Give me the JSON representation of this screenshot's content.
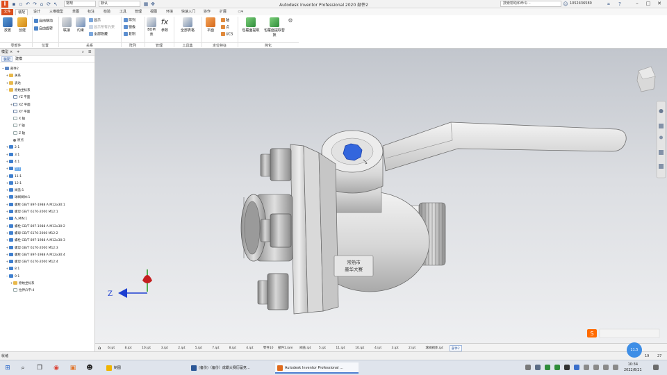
{
  "titlebar": {
    "app_letter": "I",
    "quick_access_icons": [
      "new-icon",
      "open-icon",
      "save-icon",
      "undo-icon",
      "redo-icon",
      "home-icon"
    ],
    "appearance_combo": "常规",
    "material_combo": "默认",
    "window_title": "Autodesk Inventor Professional 2020   部件2",
    "search_placeholder": "搜索帮助和命令...",
    "user_name": "1052436580",
    "window_controls": [
      "minimize",
      "maximize",
      "close"
    ]
  },
  "ribbon_tabs": {
    "file": "文件",
    "items": [
      "装配",
      "设计",
      "三维模型",
      "草图",
      "标注",
      "检验",
      "工具",
      "管理",
      "视图",
      "环境",
      "快速入门",
      "协作",
      "扩展"
    ],
    "active_index": 0
  },
  "ribbon": {
    "buttons": {
      "place": "放置",
      "create": "创建",
      "free_move": "自由移动",
      "free_rotate": "自由旋转",
      "joint": "联接",
      "constrain": "约束",
      "show": "显示",
      "show_constraints": "显示所有约束",
      "hide_all": "全部隐藏",
      "pattern": "阵列",
      "mirror": "镜像",
      "copy": "复制",
      "bom": "BOM表",
      "parameters": "参数",
      "ipart_table": "全部表格",
      "plane": "平面",
      "axis": "轴",
      "point": "点",
      "ucs": "UCS",
      "envelope": "包覆面提取",
      "envelope2": "包覆面提取替换"
    },
    "groups": [
      "零部件",
      "位置",
      "关系",
      "阵列",
      "管理",
      "工具集",
      "定位特征",
      "简化"
    ]
  },
  "browser": {
    "panel_title": "模型",
    "tabs": [
      "装配",
      "建模"
    ],
    "active_tab": 0,
    "tree": [
      {
        "label": "部件2",
        "indent": 0,
        "icon": "root",
        "exp": "−"
      },
      {
        "label": "关系",
        "indent": 1,
        "icon": "folder",
        "exp": "+"
      },
      {
        "label": "表达",
        "indent": 1,
        "icon": "folder",
        "exp": "+"
      },
      {
        "label": "原始坐标系",
        "indent": 1,
        "icon": "folder",
        "exp": "−"
      },
      {
        "label": "YZ 平面",
        "indent": 2,
        "icon": "plane",
        "exp": ""
      },
      {
        "label": "XZ 平面",
        "indent": 2,
        "icon": "plane",
        "exp": "+"
      },
      {
        "label": "XY 平面",
        "indent": 2,
        "icon": "plane",
        "exp": ""
      },
      {
        "label": "X 轴",
        "indent": 2,
        "icon": "axis",
        "exp": ""
      },
      {
        "label": "Y 轴",
        "indent": 2,
        "icon": "axis",
        "exp": ""
      },
      {
        "label": "Z 轴",
        "indent": 2,
        "icon": "axis",
        "exp": ""
      },
      {
        "label": "原点",
        "indent": 2,
        "icon": "point",
        "exp": ""
      },
      {
        "label": "2:1",
        "indent": 1,
        "icon": "part",
        "exp": "+"
      },
      {
        "label": "3:1",
        "indent": 1,
        "icon": "part",
        "exp": "+"
      },
      {
        "label": "4:1",
        "indent": 1,
        "icon": "part",
        "exp": "+"
      },
      {
        "label": "5:1",
        "indent": 1,
        "icon": "part",
        "exp": "+",
        "selected": true
      },
      {
        "label": "11:1",
        "indent": 1,
        "icon": "part",
        "exp": "+"
      },
      {
        "label": "12:1",
        "indent": 1,
        "icon": "part",
        "exp": "+"
      },
      {
        "label": "阀盖:1",
        "indent": 1,
        "icon": "part",
        "exp": "+"
      },
      {
        "label": "球阀阀体:1",
        "indent": 1,
        "icon": "part",
        "exp": "+"
      },
      {
        "label": "螺栓 GB/T 897-1988 A M12x30:1",
        "indent": 1,
        "icon": "part",
        "exp": "+"
      },
      {
        "label": "螺母 GB/T 6170-2000 M12:1",
        "indent": 1,
        "icon": "part",
        "exp": "+"
      },
      {
        "label": "A_MIN:1",
        "indent": 1,
        "icon": "part",
        "exp": "+"
      },
      {
        "label": "螺栓 GB/T 897-1988 A M12x30:2",
        "indent": 1,
        "icon": "part",
        "exp": "+"
      },
      {
        "label": "螺母 GB/T 6170-2000 M12:2",
        "indent": 1,
        "icon": "part",
        "exp": "+"
      },
      {
        "label": "螺栓 GB/T 897-1988 A M12x30:3",
        "indent": 1,
        "icon": "part",
        "exp": "+"
      },
      {
        "label": "螺母 GB/T 6170-2000 M12:3",
        "indent": 1,
        "icon": "part",
        "exp": "+"
      },
      {
        "label": "螺栓 GB/T 897-1988 A M12x30:4",
        "indent": 1,
        "icon": "part",
        "exp": "+"
      },
      {
        "label": "螺母 GB/T 6170-2000 M12:4",
        "indent": 1,
        "icon": "part",
        "exp": "+"
      },
      {
        "label": "8:1",
        "indent": 1,
        "icon": "part",
        "exp": "+"
      },
      {
        "label": "9:1",
        "indent": 1,
        "icon": "part",
        "exp": "−"
      },
      {
        "label": "原始坐标系",
        "indent": 2,
        "icon": "folder",
        "exp": "+"
      },
      {
        "label": "拉伸凸平:4",
        "indent": 2,
        "icon": "axis",
        "exp": ""
      }
    ]
  },
  "viewport": {
    "body_text_line1": "常熟市",
    "body_text_line2": "墨华大赛",
    "axis_label": "Z"
  },
  "doc_tabs": [
    "6.ipt",
    "8.ipt",
    "10.ipt",
    "3.ipt",
    "2.ipt",
    "5.ipt",
    "7.ipt",
    "8.ipt",
    "4.ipt",
    "零件10",
    "部件1.iam",
    "阀盖.ipt",
    "5.ipt",
    "11.ipt",
    "10.ipt",
    "4.ipt",
    "3.ipt",
    "2.ipt",
    "球阀阀体.ipt",
    "部件2"
  ],
  "doc_tab_active": 19,
  "statusbar": {
    "text": "就绪",
    "count1": "19",
    "count2": "27",
    "percent": "11.5"
  },
  "taskbar": {
    "apps": [
      {
        "label": "制图",
        "color": "#f0b400",
        "active": false
      },
      {
        "label": "(备份)（备份）成霸大赛历届竞...",
        "color": "#2b5797",
        "active": false
      },
      {
        "label": "Autodesk Inventor Professional ...",
        "color": "#e06a1c",
        "active": true
      }
    ],
    "time": "10:34",
    "date": "2022/6/21"
  }
}
